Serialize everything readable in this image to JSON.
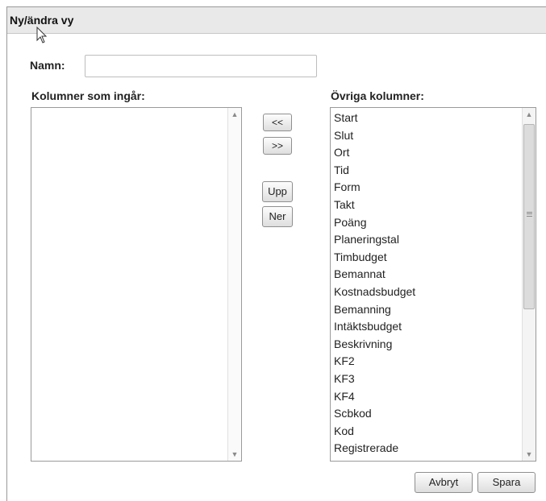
{
  "dialog": {
    "title": "Ny/ändra vy"
  },
  "form": {
    "name_label": "Namn:",
    "name_value": "",
    "name_placeholder": ""
  },
  "included": {
    "label": "Kolumner som ingår:",
    "items": []
  },
  "other": {
    "label": "Övriga kolumner:",
    "items": [
      "Start",
      "Slut",
      "Ort",
      "Tid",
      "Form",
      "Takt",
      "Poäng",
      "Planeringstal",
      "Timbudget",
      "Bemannat",
      "Kostnadsbudget",
      "Bemanning",
      "Intäktsbudget",
      "Beskrivning",
      "KF2",
      "KF3",
      "KF4",
      "Scbkod",
      "Kod",
      "Registrerade"
    ]
  },
  "buttons": {
    "move_left": "<<",
    "move_right": ">>",
    "up": "Upp",
    "down": "Ner",
    "cancel": "Avbryt",
    "save": "Spara"
  },
  "icons": {
    "scroll_up": "triangle-up",
    "scroll_down": "triangle-down",
    "cursor": "arrow-pointer"
  }
}
